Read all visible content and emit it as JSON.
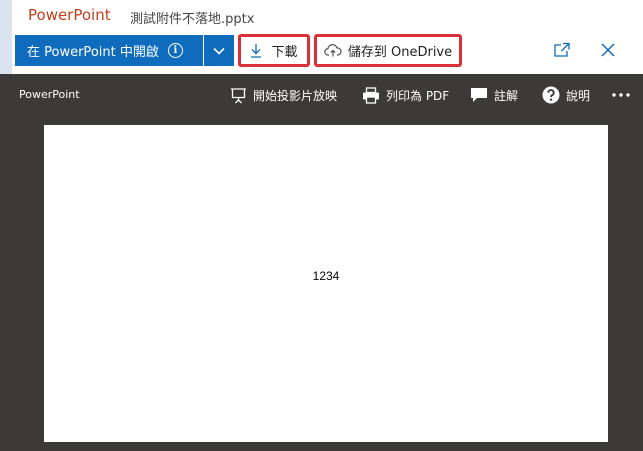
{
  "title_bar": {
    "app_name": "PowerPoint",
    "file_name": "測試附件不落地.pptx"
  },
  "action_bar": {
    "open_label": "在 PowerPoint 中開啟",
    "download_label": "下載",
    "save_label": "儲存到 OneDrive"
  },
  "viewer": {
    "brand": "PowerPoint",
    "toolbar": {
      "slideshow_label": "開始投影片放映",
      "print_label": "列印為 PDF",
      "comments_label": "註解",
      "help_label": "說明"
    },
    "slide": {
      "text": "1234"
    }
  },
  "icons": [
    "info-icon",
    "chevron-down-icon",
    "download-icon",
    "cloud-upload-icon",
    "popout-icon",
    "close-icon",
    "projector-icon",
    "printer-icon",
    "comment-icon",
    "help-icon",
    "more-icon"
  ],
  "colors": {
    "brand": "#c43e1c",
    "primary": "#0f6cbd",
    "highlight": "#d9303a",
    "viewer_bg": "#3b3a39"
  }
}
